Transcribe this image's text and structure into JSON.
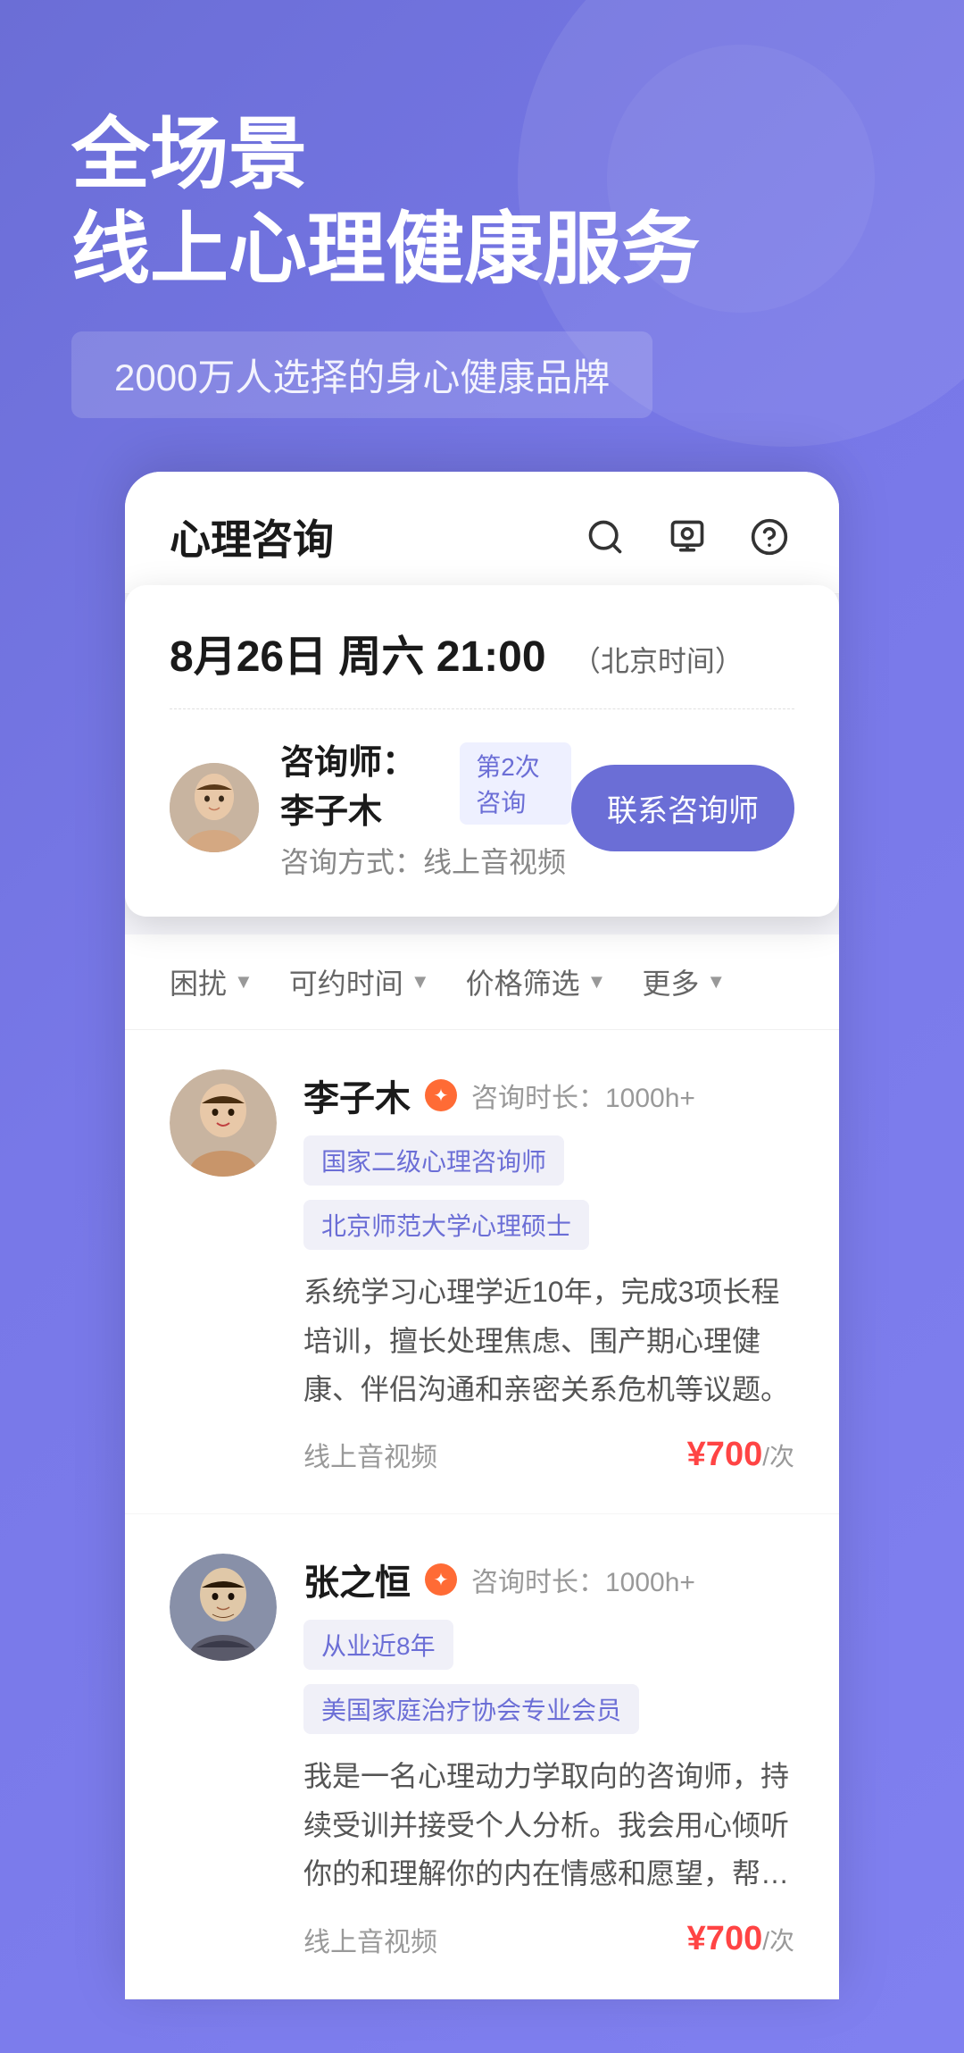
{
  "hero": {
    "title_line1": "全场景",
    "title_line2": "线上心理健康服务",
    "subtitle": "2000万人选择的身心健康品牌"
  },
  "app": {
    "header": {
      "title": "心理咨询",
      "search_icon": "search",
      "record_icon": "record",
      "help_icon": "help"
    },
    "appointment": {
      "date": "8月26日 周六 21:00",
      "timezone": "（北京时间）",
      "consultant_label": "咨询师：",
      "consultant_name": "李子木",
      "consultation_count": "第2次咨询",
      "method_label": "咨询方式：",
      "method": "线上音视频",
      "contact_button": "联系咨询师"
    },
    "filters": [
      {
        "label": "困扰",
        "has_arrow": true
      },
      {
        "label": "可约时间",
        "has_arrow": true
      },
      {
        "label": "价格筛选",
        "has_arrow": true
      },
      {
        "label": "更多",
        "has_arrow": true
      }
    ],
    "counselors": [
      {
        "name": "李子木",
        "verified": true,
        "experience": "咨询时长：1000h+",
        "tags": [
          "国家二级心理咨询师",
          "北京师范大学心理硕士"
        ],
        "description": "系统学习心理学近10年，完成3项长程培训，擅长处理焦虑、围产期心理健康、伴侣沟通和亲密关系危机等议题。",
        "service_type": "线上音视频",
        "price": "¥700",
        "price_unit": "/次",
        "gender": "female"
      },
      {
        "name": "张之恒",
        "verified": true,
        "experience": "咨询时长：1000h+",
        "tags": [
          "从业近8年",
          "美国家庭治疗协会专业会员"
        ],
        "description": "我是一名心理动力学取向的咨询师，持续受训并接受个人分析。我会用心倾听你的和理解你的内在情感和愿望，帮助你了解接纳自己。",
        "service_type": "线上音视频",
        "price": "¥700",
        "price_unit": "/次",
        "gender": "male"
      }
    ]
  }
}
